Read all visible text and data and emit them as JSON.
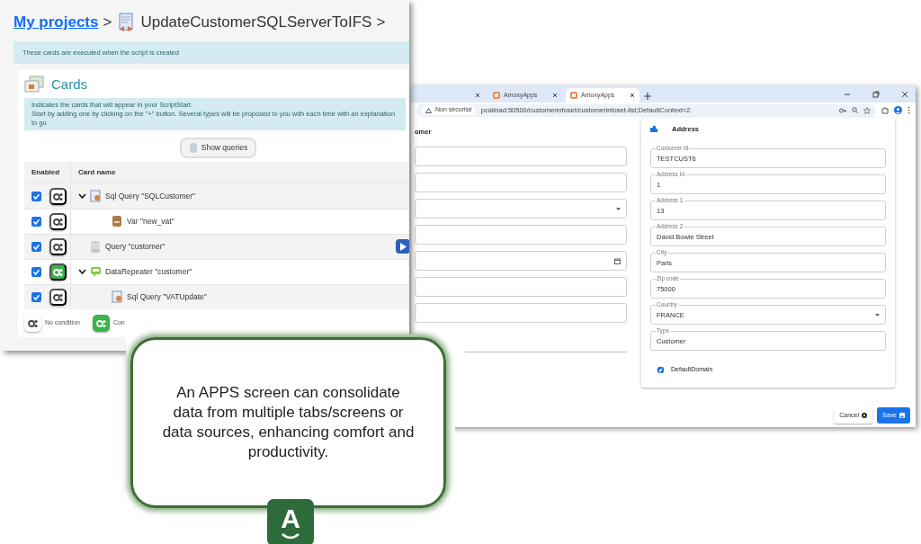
{
  "project_window": {
    "breadcrumb": {
      "root": "My projects",
      "separator": ">",
      "script": "UpdateCustomerSQLServerToIFS",
      "trailing": ">"
    },
    "info": "These cards are executed when the script is created",
    "cards_panel": {
      "title": "Cards",
      "hint_lines": [
        "Indicates the cards that will appear in your ScriptStart.",
        "Start by adding one by clicking on the \"+\" button. Several types will be proposed to you with each time with an explanation to gu"
      ],
      "show_queries_button": "Show queries",
      "columns": [
        "Enabled",
        "Card name"
      ],
      "rows": [
        {
          "name": "Sql Query \"SQLCustomer\"",
          "kind": "sql",
          "enabled": true,
          "conditional": false,
          "expanded": true,
          "run_button": false,
          "children": [
            {
              "name": "Var \"new_vat\"",
              "kind": "var",
              "enabled": true,
              "conditional": false,
              "run_button": false
            }
          ]
        },
        {
          "name": "Query \"customer\"",
          "kind": "query",
          "enabled": true,
          "conditional": false,
          "run_button": true
        },
        {
          "name": "DataRepeater \"customer\"",
          "kind": "repeater",
          "enabled": true,
          "conditional": true,
          "expanded": true,
          "run_button": false,
          "children": [
            {
              "name": "Sql Query \"VATUpdate\"",
              "kind": "sql",
              "enabled": true,
              "conditional": false,
              "run_button": false
            }
          ]
        }
      ],
      "legend": [
        {
          "label": "No condition",
          "conditional": false
        },
        {
          "label": "Con",
          "conditional": true
        }
      ]
    }
  },
  "browser_window": {
    "tabs": [
      {
        "selected": false
      },
      {
        "label": "AmoxyApps",
        "selected": false
      },
      {
        "label": "AmoxyApps",
        "selected": true
      }
    ],
    "security": "Non sécurisé",
    "url": "pcalinad:50500/customerinfoset/customerinfoset-list;DefaultContext=2",
    "form": {
      "left_heading": "omer",
      "left_fields": [
        {
          "kind": "text"
        },
        {
          "kind": "text"
        },
        {
          "kind": "select"
        },
        {
          "kind": "text"
        },
        {
          "kind": "date"
        },
        {
          "kind": "text"
        },
        {
          "kind": "text"
        }
      ],
      "address": {
        "title": "Address",
        "fields": [
          {
            "label": "Customer Id",
            "value": "TESTCUST6",
            "kind": "text"
          },
          {
            "label": "Address Id",
            "value": "1",
            "kind": "text"
          },
          {
            "label": "Address 1",
            "value": "13",
            "kind": "text"
          },
          {
            "label": "Address 2",
            "value": "David Bowie Street",
            "kind": "text"
          },
          {
            "label": "City",
            "value": "Paris",
            "kind": "text"
          },
          {
            "label": "Zip code",
            "value": "75000",
            "kind": "text"
          },
          {
            "label": "Country",
            "value": "FRANCE",
            "kind": "select"
          },
          {
            "label": "Type",
            "value": "Customer",
            "kind": "text"
          }
        ],
        "checkbox": {
          "label": "DefaultDomain",
          "checked": true
        }
      },
      "buttons": [
        {
          "label": "Cancel",
          "kind": "cancel"
        },
        {
          "label": "Save",
          "kind": "save"
        }
      ]
    }
  },
  "callout": {
    "text": "An APPS screen can consolidate data from multiple tabs/screens or data sources, enhancing comfort and productivity.",
    "logo_letter": "A"
  }
}
